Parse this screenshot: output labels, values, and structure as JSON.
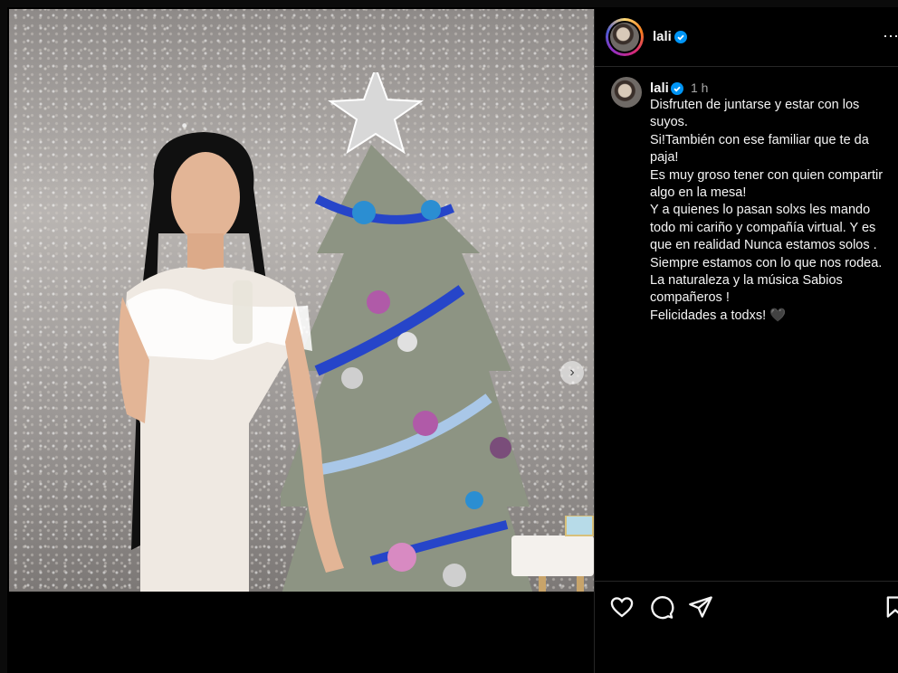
{
  "post": {
    "username": "lali",
    "time": "1 h",
    "caption_lines": [
      "Disfruten de juntarse y estar con los",
      "suyos.",
      "Si!También con ese familiar que te da",
      "paja!",
      "Es muy groso tener con quien compartir",
      "algo en la mesa!",
      "Y a quienes lo pasan solxs les mando",
      "todo mi cariño y compañía virtual. Y es",
      "que en realidad Nunca estamos solos .",
      "Siempre estamos con lo que nos rodea.",
      "La naturaleza y la música Sabios",
      "compañeros !",
      "Felicidades a todxs! 🖤"
    ]
  },
  "icons": {
    "verified": "verified-badge-icon",
    "more": "more-options-icon",
    "next": "chevron-right-icon",
    "like": "heart-icon",
    "comment": "comment-icon",
    "share": "send-icon",
    "save": "bookmark-icon"
  },
  "colors": {
    "verified": "#0095f6",
    "text": "#f5f5f5",
    "muted": "#a8a8a8"
  }
}
